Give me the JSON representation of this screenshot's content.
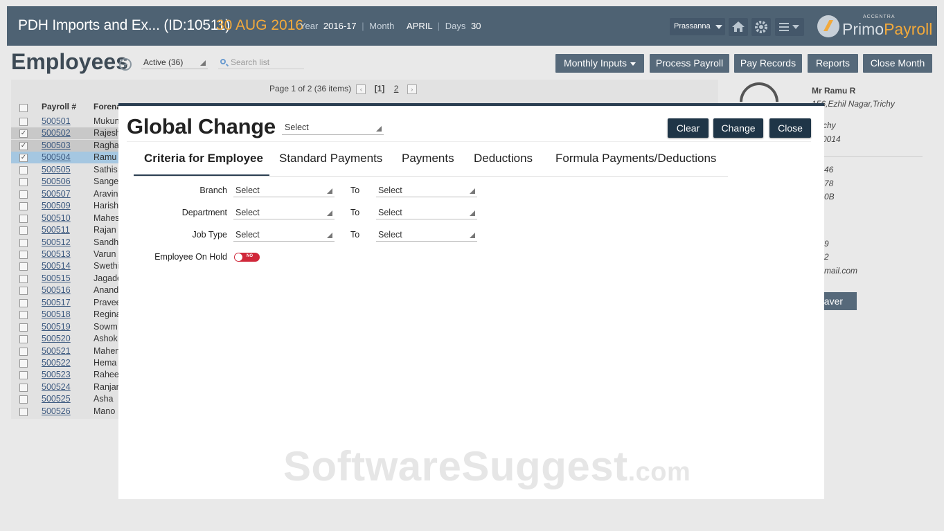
{
  "header": {
    "company": "PDH Imports and Ex... (ID:10511)",
    "date": "30 AUG 2016",
    "year_label": "Year",
    "year_value": "2016-17",
    "month_label": "Month",
    "month_value": "APRIL",
    "days_label": "Days",
    "days_value": "30",
    "user": "Prassanna",
    "logo_small": "ACCENTRA",
    "logo_primo": "Primo",
    "logo_payroll": "Payroll"
  },
  "employees": {
    "title": "Employees",
    "status_filter": "Active (36)",
    "search_placeholder": "Search list",
    "actions": {
      "monthly_inputs": "Monthly Inputs",
      "process_payroll": "Process Payroll",
      "pay_records": "Pay Records",
      "reports": "Reports",
      "close_month": "Close Month"
    },
    "pager": {
      "text": "Page 1 of 2 (36 items)",
      "page1": "[1]",
      "page2": "2"
    },
    "columns": {
      "payroll": "Payroll #",
      "forename": "Forena"
    },
    "rows": [
      {
        "id": "500501",
        "name": "Mukun",
        "checked": false
      },
      {
        "id": "500502",
        "name": "Rajesh",
        "checked": true
      },
      {
        "id": "500503",
        "name": "Ragha",
        "checked": true
      },
      {
        "id": "500504",
        "name": "Ramu",
        "checked": true
      },
      {
        "id": "500505",
        "name": "Sathis",
        "checked": false
      },
      {
        "id": "500506",
        "name": "Sange",
        "checked": false
      },
      {
        "id": "500507",
        "name": "Aravin",
        "checked": false
      },
      {
        "id": "500509",
        "name": "Harish",
        "checked": false
      },
      {
        "id": "500510",
        "name": "Mahes",
        "checked": false
      },
      {
        "id": "500511",
        "name": "Rajan",
        "checked": false
      },
      {
        "id": "500512",
        "name": "Sandh",
        "checked": false
      },
      {
        "id": "500513",
        "name": "Varun",
        "checked": false
      },
      {
        "id": "500514",
        "name": "Swethi",
        "checked": false
      },
      {
        "id": "500515",
        "name": "Jagade",
        "checked": false
      },
      {
        "id": "500516",
        "name": "Anand",
        "checked": false
      },
      {
        "id": "500517",
        "name": "Pravee",
        "checked": false
      },
      {
        "id": "500518",
        "name": "Regina",
        "checked": false
      },
      {
        "id": "500519",
        "name": "Sowm",
        "checked": false
      },
      {
        "id": "500520",
        "name": "Ashok",
        "checked": false
      },
      {
        "id": "500521",
        "name": "Mahen",
        "checked": false
      },
      {
        "id": "500522",
        "name": "Hema",
        "checked": false
      },
      {
        "id": "500523",
        "name": "Raheel",
        "checked": false
      },
      {
        "id": "500524",
        "name": "Ranjan",
        "checked": false
      },
      {
        "id": "500525",
        "name": "Asha",
        "checked": false
      },
      {
        "id": "500526",
        "name": "Mano",
        "checked": false
      }
    ]
  },
  "detail": {
    "name": "Mr Ramu R",
    "address": "156,Ezhil Nagar,Trichy",
    "city": "chy",
    "pin": "0014",
    "line1": "46",
    "line2": "78",
    "line3": "0B",
    "line4": "9",
    "line5": "2",
    "email": "mail.com",
    "leaver_button": "eaver"
  },
  "modal": {
    "title": "Global Change",
    "select_value": "Select",
    "clear": "Clear",
    "change": "Change",
    "close": "Close",
    "tabs": [
      "Criteria for Employee",
      "Standard Payments",
      "Payments",
      "Deductions",
      "Formula Payments/Deductions"
    ],
    "criteria": [
      {
        "label": "Branch",
        "from": "Select",
        "to_label": "To",
        "to": "Select"
      },
      {
        "label": "Department",
        "from": "Select",
        "to_label": "To",
        "to": "Select"
      },
      {
        "label": "Job Type",
        "from": "Select",
        "to_label": "To",
        "to": "Select"
      }
    ],
    "on_hold_label": "Employee On Hold",
    "on_hold_toggle": "NO"
  },
  "watermark": {
    "main": "SoftwareSuggest",
    "suffix": ".com"
  },
  "colors": {
    "header_bg": "#4e6273",
    "accent": "#f2a93b",
    "modal_btn": "#1f3547",
    "toggle_off": "#d0283a"
  }
}
